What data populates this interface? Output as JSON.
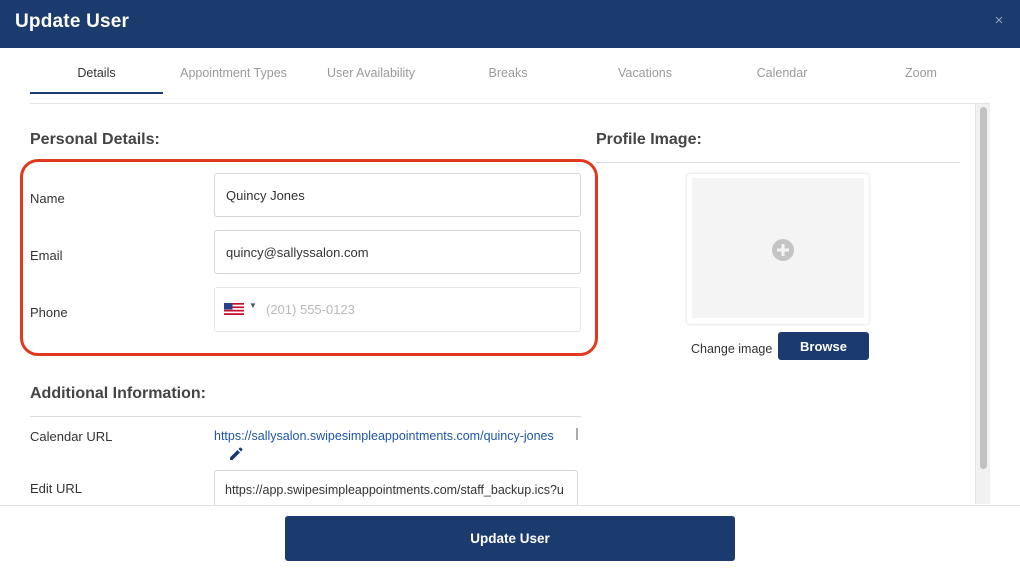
{
  "header": {
    "title": "Update User",
    "close_glyph": "×"
  },
  "tabs": [
    {
      "label": "Details",
      "active": true
    },
    {
      "label": "Appointment Types"
    },
    {
      "label": "User Availability"
    },
    {
      "label": "Breaks"
    },
    {
      "label": "Vacations"
    },
    {
      "label": "Calendar"
    },
    {
      "label": "Zoom"
    }
  ],
  "personal": {
    "title": "Personal Details:",
    "name_label": "Name",
    "name_value": "Quincy Jones",
    "email_label": "Email",
    "email_value": "quincy@sallyssalon.com",
    "phone_label": "Phone",
    "phone_placeholder": "(201) 555-0123",
    "phone_country": "us-flag-icon",
    "caret": "▼"
  },
  "additional": {
    "title": "Additional Information:",
    "calendar_url_label": "Calendar URL",
    "calendar_url_value": "https://sallysalon.swipesimpleappointments.com/quincy-jones",
    "edit_url_label": "Edit URL",
    "edit_url_value": "https://app.swipesimpleappointments.com/staff_backup.ics?u"
  },
  "profile": {
    "title": "Profile Image:",
    "change_label": "Change image",
    "browse_label": "Browse"
  },
  "footer": {
    "update_label": "Update User"
  },
  "colors": {
    "brand": "#1b3a6d",
    "highlight": "#e2391e",
    "link": "#1f56a8"
  }
}
